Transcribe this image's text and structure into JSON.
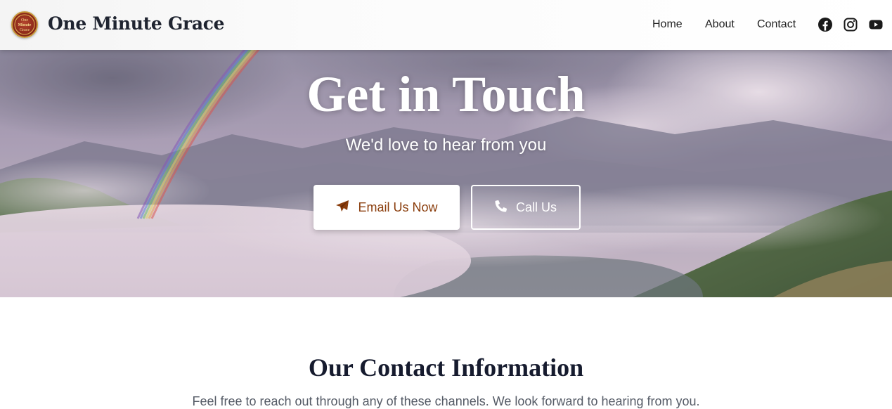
{
  "header": {
    "brand": "One Minute Grace",
    "logo_text": [
      "One",
      "Minute",
      "Grace"
    ],
    "nav": [
      {
        "label": "Home"
      },
      {
        "label": "About"
      },
      {
        "label": "Contact"
      }
    ],
    "social": [
      "facebook-icon",
      "instagram-icon",
      "youtube-icon"
    ]
  },
  "hero": {
    "title": "Get in Touch",
    "subtitle": "We'd love to hear from you",
    "email_button": "Email Us Now",
    "call_button": "Call Us",
    "email_icon": "paper-plane-icon",
    "call_icon": "phone-icon"
  },
  "contact": {
    "title": "Our Contact Information",
    "description": "Feel free to reach out through any of these channels. We look forward to hearing from you."
  },
  "colors": {
    "brand_text": "#1f2430",
    "email_button_text": "#8a3d0c",
    "section_title": "#161b2e"
  }
}
